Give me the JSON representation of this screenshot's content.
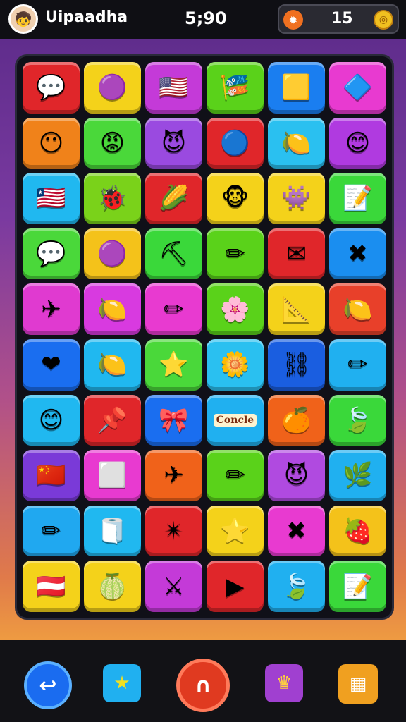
{
  "header": {
    "title": "Uipaadha",
    "timer": "5;90",
    "coins": "15",
    "left_icon": "gear-face-icon",
    "right_icon": "coin-icon"
  },
  "board": {
    "rows": [
      [
        {
          "c": "#e0262a",
          "g": "💬"
        },
        {
          "c": "#f4d21a",
          "g": "🟣"
        },
        {
          "c": "#c43ad8",
          "g": "🇺🇸"
        },
        {
          "c": "#5ad21a",
          "g": "🎏"
        },
        {
          "c": "#1a7ef0",
          "g": "🟨"
        },
        {
          "c": "#e83ad0",
          "g": "🔷"
        }
      ],
      [
        {
          "c": "#f0821a",
          "g": "😶"
        },
        {
          "c": "#4ad83a",
          "g": "😡"
        },
        {
          "c": "#9a4ae0",
          "g": "😈"
        },
        {
          "c": "#e0262a",
          "g": "🔵"
        },
        {
          "c": "#2ac0f0",
          "g": "🍋"
        },
        {
          "c": "#b03ae0",
          "g": "😊"
        }
      ],
      [
        {
          "c": "#20b8f0",
          "g": "🇱🇷"
        },
        {
          "c": "#7ad21a",
          "g": "🐞"
        },
        {
          "c": "#e0262a",
          "g": "🌽"
        },
        {
          "c": "#f4d21a",
          "g": "🐵"
        },
        {
          "c": "#f4d21a",
          "g": "👾"
        },
        {
          "c": "#3ad83a",
          "g": "📝"
        }
      ],
      [
        {
          "c": "#4ad83a",
          "g": "💬"
        },
        {
          "c": "#f4c21a",
          "g": "🟣"
        },
        {
          "c": "#3ad83a",
          "g": "⛏"
        },
        {
          "c": "#5ad21a",
          "g": "✏"
        },
        {
          "c": "#e0262a",
          "g": "✉"
        },
        {
          "c": "#1a8ef0",
          "g": "✖"
        }
      ],
      [
        {
          "c": "#e03ad0",
          "g": "✈"
        },
        {
          "c": "#d83ae0",
          "g": "🍋"
        },
        {
          "c": "#e83ad0",
          "g": "✏"
        },
        {
          "c": "#5ad21a",
          "g": "🌸"
        },
        {
          "c": "#f4d21a",
          "g": "📐"
        },
        {
          "c": "#e8402a",
          "g": "🍋"
        }
      ],
      [
        {
          "c": "#1a6ef0",
          "g": "❤"
        },
        {
          "c": "#20b8f0",
          "g": "🍋"
        },
        {
          "c": "#4ad83a",
          "g": "⭐"
        },
        {
          "c": "#2ac0f0",
          "g": "🌼"
        },
        {
          "c": "#1a5ee0",
          "g": "⛓"
        },
        {
          "c": "#20b0f0",
          "g": "✏"
        }
      ],
      [
        {
          "c": "#20b8f0",
          "g": "😊"
        },
        {
          "c": "#e0262a",
          "g": "📌"
        },
        {
          "c": "#1a6ef0",
          "g": "🎀"
        },
        {
          "c": "#20b0f0",
          "g": "",
          "t": "Concle"
        },
        {
          "c": "#f0621a",
          "g": "🍊"
        },
        {
          "c": "#3ad83a",
          "g": "🍃"
        }
      ],
      [
        {
          "c": "#7a3ad8",
          "g": "🇨🇳"
        },
        {
          "c": "#e83ad0",
          "g": "⬜"
        },
        {
          "c": "#f0621a",
          "g": "✈"
        },
        {
          "c": "#5ad21a",
          "g": "✏"
        },
        {
          "c": "#b04ae0",
          "g": "😈"
        },
        {
          "c": "#20b0f0",
          "g": "🌿"
        }
      ],
      [
        {
          "c": "#20a8f0",
          "g": "✏"
        },
        {
          "c": "#20b8f0",
          "g": "🧻"
        },
        {
          "c": "#e0262a",
          "g": "✴"
        },
        {
          "c": "#f4d21a",
          "g": "⭐"
        },
        {
          "c": "#e83ad0",
          "g": "✖"
        },
        {
          "c": "#f4c21a",
          "g": "🍓"
        }
      ],
      [
        {
          "c": "#f4d21a",
          "g": "🇦🇹"
        },
        {
          "c": "#f4d21a",
          "g": "🍈"
        },
        {
          "c": "#c43ad8",
          "g": "⚔"
        },
        {
          "c": "#e0262a",
          "g": "▶"
        },
        {
          "c": "#20b0f0",
          "g": "🍃"
        },
        {
          "c": "#3ad83a",
          "g": "📝"
        }
      ]
    ]
  },
  "toolbar": {
    "back_icon": "back-arrow-icon",
    "star_icon": "star-arrow-icon",
    "center_icon": "magnet-icon",
    "crown_icon": "crown-icon",
    "menu_icon": "menu-grid-icon"
  }
}
